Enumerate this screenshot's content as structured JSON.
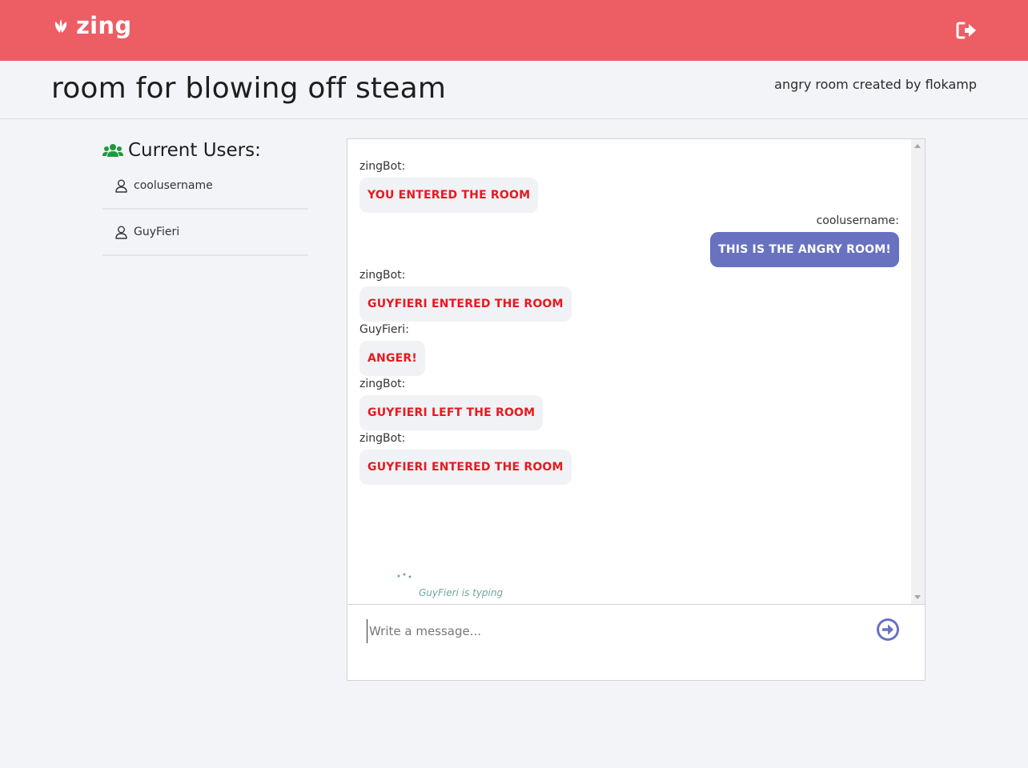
{
  "navbar": {
    "brand": "zing",
    "brand_icon": "sprout-icon",
    "logout_icon": "sign-out-icon",
    "background": "#ec5d64"
  },
  "room": {
    "title": "room for blowing off steam",
    "meta": "angry room created by flokamp"
  },
  "users_panel": {
    "heading": "Current Users:",
    "heading_icon": "users-icon",
    "users": [
      {
        "name": "coolusername",
        "icon": "user-icon"
      },
      {
        "name": "GuyFieri",
        "icon": "user-icon"
      }
    ]
  },
  "chat": {
    "messages": [
      {
        "sender": "zingBot:",
        "text": "YOU ENTERED THE ROOM",
        "kind": "bot",
        "side": "left"
      },
      {
        "sender": "coolusername:",
        "text": "THIS IS THE ANGRY ROOM!",
        "kind": "me",
        "side": "right"
      },
      {
        "sender": "zingBot:",
        "text": "GUYFIERI ENTERED THE ROOM",
        "kind": "bot",
        "side": "left"
      },
      {
        "sender": "GuyFieri:",
        "text": "ANGER!",
        "kind": "bot",
        "side": "left"
      },
      {
        "sender": "zingBot:",
        "text": "GUYFIERI LEFT THE ROOM",
        "kind": "bot",
        "side": "left"
      },
      {
        "sender": "zingBot:",
        "text": "GUYFIERI ENTERED THE ROOM",
        "kind": "bot",
        "side": "left"
      }
    ],
    "typing_indicator": "GuyFieri is typing",
    "composer": {
      "placeholder": "Write a message...",
      "send_icon": "arrow-circle-right-icon"
    },
    "colors": {
      "bot_text": "#e8191e",
      "own_bubble": "#6872c0",
      "typing": "#6ea89c"
    }
  }
}
